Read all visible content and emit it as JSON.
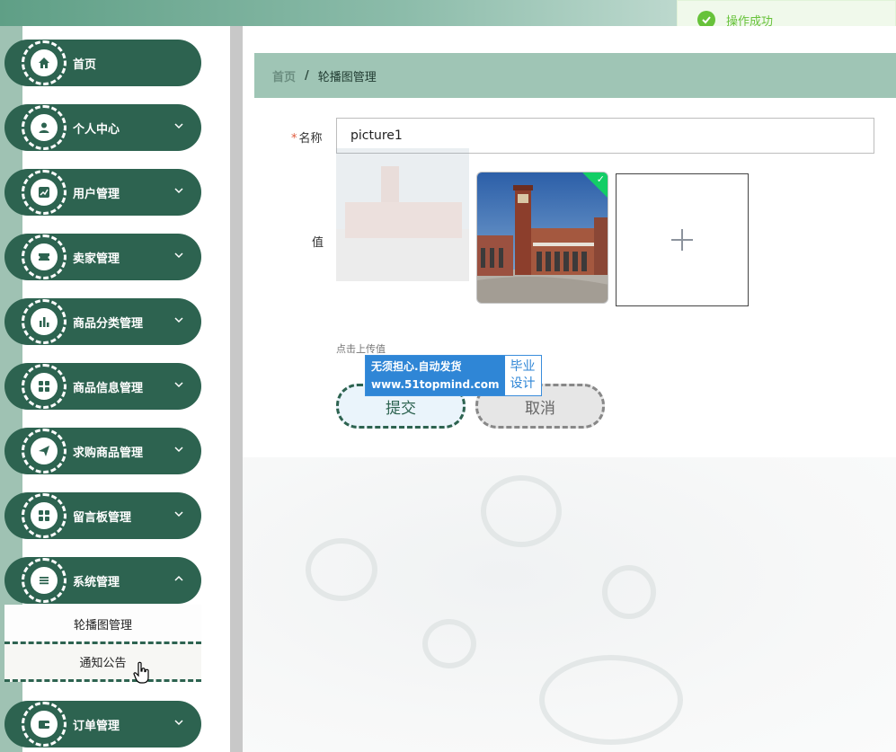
{
  "toast": {
    "text": "操作成功",
    "icon": "check-circle-icon",
    "color": "#67c23a"
  },
  "sidebar": {
    "items": [
      {
        "label": "首页",
        "icon": "home-icon",
        "has_arrow": false
      },
      {
        "label": "个人中心",
        "icon": "user-icon",
        "has_arrow": true
      },
      {
        "label": "用户管理",
        "icon": "chart-line-icon",
        "has_arrow": true
      },
      {
        "label": "卖家管理",
        "icon": "ticket-icon",
        "has_arrow": true
      },
      {
        "label": "商品分类管理",
        "icon": "bar-chart-icon",
        "has_arrow": true
      },
      {
        "label": "商品信息管理",
        "icon": "grid-icon",
        "has_arrow": true
      },
      {
        "label": "求购商品管理",
        "icon": "send-icon",
        "has_arrow": true
      },
      {
        "label": "留言板管理",
        "icon": "grid-icon",
        "has_arrow": true
      },
      {
        "label": "系统管理",
        "icon": "list-icon",
        "has_arrow": true
      },
      {
        "label": "订单管理",
        "icon": "wallet-icon",
        "has_arrow": true
      }
    ],
    "submenu": [
      {
        "label": "轮播图管理"
      },
      {
        "label": "通知公告"
      }
    ]
  },
  "breadcrumb": {
    "home": "首页",
    "separator": "/",
    "current": "轮播图管理"
  },
  "form": {
    "name_label": "名称",
    "required_mark": "*",
    "name_value": "picture1",
    "value_label": "值",
    "upload_tip": "点击上传值",
    "submit_label": "提交",
    "cancel_label": "取消"
  },
  "watermark": {
    "line1": "无须担心.自动发货",
    "line2": "www.51topmind.com",
    "right1": "毕业",
    "right2": "设计"
  },
  "colors": {
    "primary": "#2d6350",
    "breadcrumb_bg": "#9fc5b5",
    "accent_strip": "#9fc2b3"
  }
}
